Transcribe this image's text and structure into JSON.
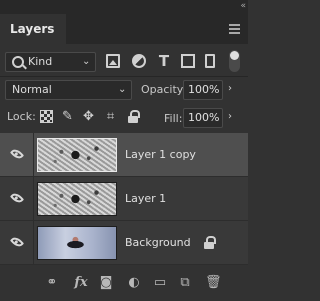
{
  "panel": {
    "tab_label": "Layers",
    "collapse_glyph": "«"
  },
  "filter": {
    "kind_label": "Kind",
    "filter_icons": [
      "image-filter-icon",
      "adjustment-filter-icon",
      "type-filter-icon",
      "shape-filter-icon",
      "smart-object-filter-icon"
    ]
  },
  "blend": {
    "mode": "Normal",
    "opacity_label": "Opacity:",
    "opacity_value": "100%"
  },
  "lock": {
    "label": "Lock:",
    "fill_label": "Fill:",
    "fill_value": "100%"
  },
  "layers": [
    {
      "name": "Layer 1 copy",
      "visible": true,
      "selected": true,
      "locked": false
    },
    {
      "name": "Layer 1",
      "visible": true,
      "selected": false,
      "locked": false
    },
    {
      "name": "Background",
      "visible": true,
      "selected": false,
      "locked": true
    }
  ],
  "bottom_bar": {
    "fx_label": "fx",
    "icons": [
      "link-layers-icon",
      "fx-icon",
      "add-mask-icon",
      "new-adjustment-icon",
      "new-group-icon",
      "new-layer-icon",
      "delete-layer-icon"
    ]
  },
  "colors": {
    "panel_bg": "#323232",
    "selected_row": "#4f4f4f",
    "text": "#e0e0e0"
  }
}
